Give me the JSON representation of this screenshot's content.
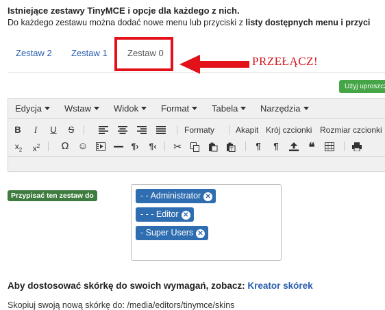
{
  "intro": {
    "title": "Istniejące zestawy TinyMCE i opcje dla każdego z nich.",
    "desc_before": "Do każdego zestawu można dodać nowe menu lub przyciski z ",
    "desc_bold": "listy dostępnych menu i przyci"
  },
  "tabs": [
    {
      "label": "Zestaw 2"
    },
    {
      "label": "Zestaw 1"
    },
    {
      "label": "Zestaw 0"
    }
  ],
  "active_tab": "Zestaw 0",
  "annotation": {
    "callout": "PRZEŁĄCZ!",
    "color": "#e2111a"
  },
  "green_button": {
    "label": "Użyj uproszcz"
  },
  "menubar": [
    {
      "label": "Edycja"
    },
    {
      "label": "Wstaw"
    },
    {
      "label": "Widok"
    },
    {
      "label": "Format"
    },
    {
      "label": "Tabela"
    },
    {
      "label": "Narzędzia"
    }
  ],
  "toolbar": {
    "formats": "Formaty",
    "paragraph": "Akapit",
    "font_family": "Krój czcionki",
    "font_size": "Rozmiar czcionki"
  },
  "assign": {
    "label": "Przypisać ten zestaw do",
    "chips": [
      {
        "label": "- - Administrator"
      },
      {
        "label": "- - - Editor"
      },
      {
        "label": "- Super Users"
      }
    ]
  },
  "skins": {
    "heading": "Aby dostosować skórkę do swoich wymagań, zobacz: ",
    "link": "Kreator skórek",
    "path": "Skopiuj swoją nową skórkę do: /media/editors/tinymce/skins"
  },
  "colors": {
    "link": "#2a5db0",
    "chip": "#2f6db1",
    "green": "#46a546",
    "badge": "#3e7b3e",
    "highlight": "#e2111a"
  }
}
